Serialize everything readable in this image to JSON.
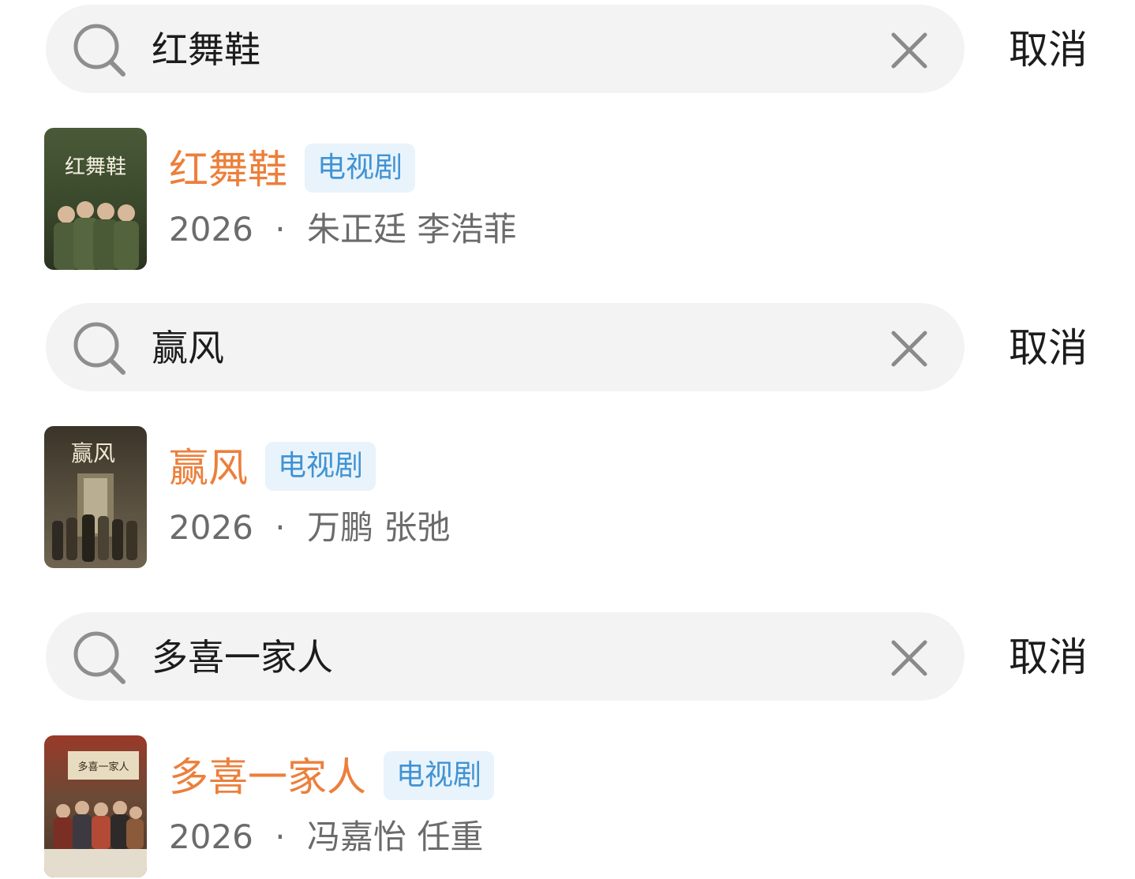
{
  "cancel_label": "取消",
  "type_label": "电视剧",
  "searches": [
    {
      "query": "红舞鞋",
      "result": {
        "title": "红舞鞋",
        "year": "2026",
        "separator": "·",
        "cast": "朱正廷 李浩菲",
        "poster_text": "红舞鞋"
      }
    },
    {
      "query": "赢风",
      "result": {
        "title": "赢风",
        "year": "2026",
        "separator": "·",
        "cast": "万鹏 张弛",
        "poster_text": "赢风"
      }
    },
    {
      "query": "多喜一家人",
      "result": {
        "title": "多喜一家人",
        "year": "2026",
        "separator": "·",
        "cast": "冯嘉怡 任重",
        "poster_text": "多喜一家人"
      }
    }
  ],
  "colors": {
    "title": "#ec7f3b",
    "badge_text": "#3f93d4",
    "badge_bg": "#e9f3fb",
    "search_bg": "#f3f3f3",
    "meta": "#6b6b6b"
  }
}
